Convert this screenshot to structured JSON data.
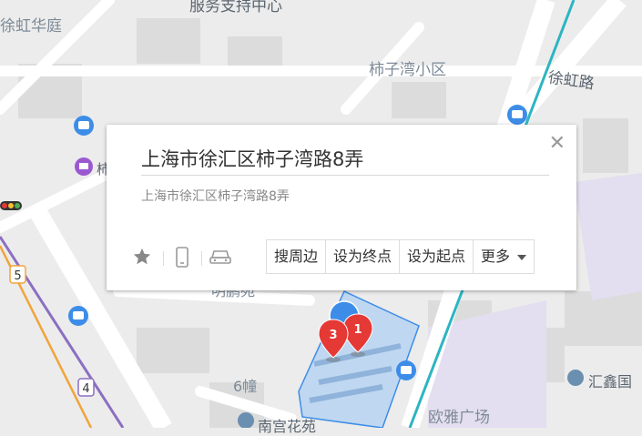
{
  "map": {
    "labels": {
      "xuhong_garden": "徐虹华庭",
      "service_center": "服务支持中心",
      "shizi_wan_community": "柿子湾小区",
      "xuhong_road": "徐虹路",
      "shi_fragment": "柿",
      "building_6": "6幢",
      "ouya_plaza": "欧雅广场",
      "huixin": "汇鑫国",
      "nangong": "南宫花苑",
      "mingpeng": "明鹏苑"
    },
    "route_badges": {
      "route_5": "5",
      "route_4": "4"
    },
    "markers": [
      {
        "label": "1"
      },
      {
        "label": "3"
      }
    ],
    "colors": {
      "popup_bg": "#ffffff",
      "marker_red": "#e53935",
      "location_blue": "#3d8de8",
      "area_fill": "#a8ccf2",
      "metro_purple": "#8b6fc0",
      "metro_orange": "#f2a33a"
    }
  },
  "popup": {
    "title": "上海市徐汇区柿子湾路8弄",
    "address": "上海市徐汇区柿子湾路8弄",
    "close_icon": "close-icon",
    "icons": [
      "star-icon",
      "phone-icon",
      "car-icon"
    ],
    "actions": {
      "search_nearby": "搜周边",
      "set_destination": "设为终点",
      "set_start": "设为起点",
      "more": "更多"
    }
  }
}
